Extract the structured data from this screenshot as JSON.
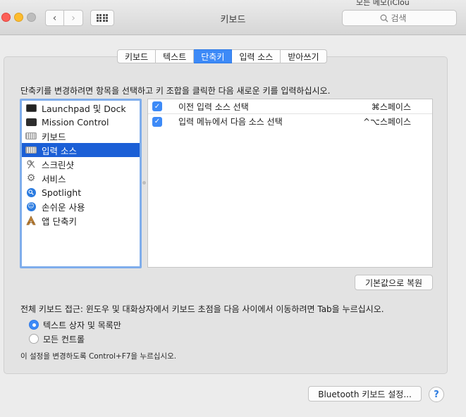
{
  "window": {
    "title": "키보드"
  },
  "background_peek": {
    "text": "모든 메모(iClou"
  },
  "search": {
    "placeholder": "검색"
  },
  "tabs": [
    {
      "label": "키보드",
      "active": false
    },
    {
      "label": "텍스트",
      "active": false
    },
    {
      "label": "단축키",
      "active": true
    },
    {
      "label": "입력 소스",
      "active": false
    },
    {
      "label": "받아쓰기",
      "active": false
    }
  ],
  "instruction": "단축키를 변경하려면 항목을 선택하고 키 조합을 클릭한 다음 새로운 키를 입력하십시오.",
  "categories": [
    {
      "label": "Launchpad 및 Dock",
      "icon": "launchpad-icon"
    },
    {
      "label": "Mission Control",
      "icon": "mission-control-icon"
    },
    {
      "label": "키보드",
      "icon": "keyboard-icon"
    },
    {
      "label": "입력 소스",
      "icon": "keyboard-icon",
      "selected": true
    },
    {
      "label": "스크린샷",
      "icon": "screenshot-icon"
    },
    {
      "label": "서비스",
      "icon": "gear-icon"
    },
    {
      "label": "Spotlight",
      "icon": "spotlight-icon"
    },
    {
      "label": "손쉬운 사용",
      "icon": "accessibility-icon"
    },
    {
      "label": "앱 단축키",
      "icon": "app-shortcuts-icon"
    }
  ],
  "shortcuts": [
    {
      "label": "이전 입력 소스 선택",
      "keys": "⌘스페이스",
      "checked": true
    },
    {
      "label": "입력 메뉴에서 다음 소스 선택",
      "keys": "^⌥스페이스",
      "checked": true
    }
  ],
  "restore_button": "기본값으로 복원",
  "full_keyboard_access": {
    "label": "전체 키보드 접근: 윈도우 및 대화상자에서 키보드 초점을 다음 사이에서 이동하려면 Tab을 누르십시오.",
    "options": [
      {
        "label": "텍스트 상자 및 목록만",
        "selected": true
      },
      {
        "label": "모든 컨트롤",
        "selected": false
      }
    ]
  },
  "hint": "이 설정을 변경하도록 Control+F7을 누르십시오.",
  "bluetooth_button": "Bluetooth 키보드 설정...",
  "help_button": "?",
  "colors": {
    "accent": "#3d8af7",
    "selection": "#1b5fd6",
    "focus_ring": "#7fadeb"
  }
}
